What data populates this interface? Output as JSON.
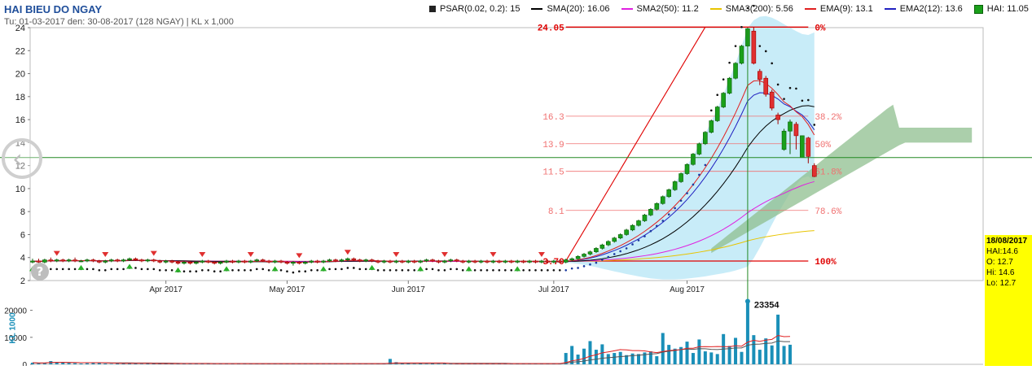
{
  "header": {
    "title": "HAI BIEU DO NGAY",
    "subtitle": "Tu: 01-03-2017 den: 30-08-2017 (128 NGAY) | KL x 1,000"
  },
  "legend": [
    {
      "label": "PSAR(0.02, 0.2): 15",
      "color": "#222222",
      "kind": "square"
    },
    {
      "label": "SMA(20): 16.06",
      "color": "#000000",
      "kind": "line"
    },
    {
      "label": "SMA2(50): 11.2",
      "color": "#e020e0",
      "kind": "line"
    },
    {
      "label": "SMA3(200): 5.56",
      "color": "#e8c400",
      "kind": "line"
    },
    {
      "label": "EMA(9): 13.1",
      "color": "#e02020",
      "kind": "line"
    },
    {
      "label": "EMA2(12): 13.6",
      "color": "#2020c0",
      "kind": "line"
    },
    {
      "label": "HAI: 11.05",
      "color": "#1aa01a",
      "kind": "green"
    }
  ],
  "info_box": {
    "date": "18/08/2017",
    "hai": "HAI:14.6",
    "open": "O: 12.7",
    "high": "Hi: 14.6",
    "low": "Lo: 12.7"
  },
  "colors": {
    "up": "#1aa01a",
    "down": "#e03030",
    "band": "#c8ecf8",
    "cloud": "#8fbf8f",
    "fib": "#f07070",
    "volume": "#1a8fb8",
    "crosshair": "#228822"
  },
  "chart_data": {
    "type": "candlestick",
    "price_axis": {
      "ylim": [
        2,
        24
      ],
      "ticks": [
        2,
        4,
        6,
        8,
        10,
        12,
        14,
        16,
        18,
        20,
        22,
        24
      ]
    },
    "x_ticks": [
      "Apr 2017",
      "May 2017",
      "Jun 2017",
      "Jul 2017",
      "Aug 2017"
    ],
    "x_tick_index": [
      22,
      42,
      62,
      86,
      108
    ],
    "n_days": 128,
    "crosshair": {
      "index": 118,
      "price": 12.7
    },
    "fibonacci": {
      "levels": [
        {
          "value": "24.05",
          "percent": "0%",
          "price": 24.05
        },
        {
          "value": "16.3",
          "percent": "38.2%",
          "price": 16.3
        },
        {
          "value": "13.9",
          "percent": "50%",
          "price": 13.9
        },
        {
          "value": "11.5",
          "percent": "61.8%",
          "price": 11.5
        },
        {
          "value": "8.1",
          "percent": "78.6%",
          "price": 8.1
        },
        {
          "value": "3.70",
          "percent": "100%",
          "price": 3.7
        }
      ],
      "from_index": 88,
      "to_index": 128,
      "trend_from": {
        "index": 88,
        "price": 3.7
      },
      "trend_to": {
        "index": 111,
        "price": 24.05
      }
    },
    "candles": [
      {
        "open": 3.6,
        "close": 3.7,
        "high": 3.9,
        "low": 3.5
      },
      {
        "open": 3.7,
        "close": 3.6,
        "high": 3.9,
        "low": 3.5
      },
      {
        "open": 3.6,
        "close": 3.8,
        "high": 3.9,
        "low": 3.5
      },
      {
        "open": 3.8,
        "close": 3.7,
        "high": 4.0,
        "low": 3.6
      },
      {
        "open": 3.7,
        "close": 3.8,
        "high": 3.9,
        "low": 3.6
      },
      {
        "open": 3.8,
        "close": 3.7,
        "high": 3.9,
        "low": 3.6
      },
      {
        "open": 3.7,
        "close": 3.8,
        "high": 3.9,
        "low": 3.6
      },
      {
        "open": 3.8,
        "close": 3.7,
        "high": 4.0,
        "low": 3.6
      },
      {
        "open": 3.7,
        "close": 3.7,
        "high": 3.8,
        "low": 3.6
      },
      {
        "open": 3.7,
        "close": 3.8,
        "high": 3.9,
        "low": 3.6
      },
      {
        "open": 3.8,
        "close": 3.7,
        "high": 3.9,
        "low": 3.6
      },
      {
        "open": 3.7,
        "close": 3.6,
        "high": 3.8,
        "low": 3.5
      },
      {
        "open": 3.6,
        "close": 3.7,
        "high": 3.8,
        "low": 3.5
      },
      {
        "open": 3.7,
        "close": 3.8,
        "high": 3.9,
        "low": 3.6
      },
      {
        "open": 3.8,
        "close": 3.7,
        "high": 3.9,
        "low": 3.6
      },
      {
        "open": 3.7,
        "close": 3.8,
        "high": 3.9,
        "low": 3.6
      },
      {
        "open": 3.8,
        "close": 3.9,
        "high": 4.0,
        "low": 3.7
      },
      {
        "open": 3.9,
        "close": 3.8,
        "high": 4.0,
        "low": 3.7
      },
      {
        "open": 3.8,
        "close": 3.7,
        "high": 3.9,
        "low": 3.6
      },
      {
        "open": 3.7,
        "close": 3.8,
        "high": 3.9,
        "low": 3.6
      },
      {
        "open": 3.8,
        "close": 3.7,
        "high": 3.9,
        "low": 3.6
      },
      {
        "open": 3.7,
        "close": 3.6,
        "high": 3.8,
        "low": 3.5
      },
      {
        "open": 3.6,
        "close": 3.7,
        "high": 3.8,
        "low": 3.5
      },
      {
        "open": 3.7,
        "close": 3.6,
        "high": 3.8,
        "low": 3.5
      },
      {
        "open": 3.6,
        "close": 3.5,
        "high": 3.7,
        "low": 3.4
      },
      {
        "open": 3.5,
        "close": 3.6,
        "high": 3.7,
        "low": 3.4
      },
      {
        "open": 3.6,
        "close": 3.5,
        "high": 3.7,
        "low": 3.4
      },
      {
        "open": 3.5,
        "close": 3.6,
        "high": 3.7,
        "low": 3.4
      },
      {
        "open": 3.6,
        "close": 3.7,
        "high": 3.8,
        "low": 3.5
      },
      {
        "open": 3.7,
        "close": 3.6,
        "high": 3.8,
        "low": 3.5
      },
      {
        "open": 3.6,
        "close": 3.5,
        "high": 3.7,
        "low": 3.4
      },
      {
        "open": 3.5,
        "close": 3.6,
        "high": 3.7,
        "low": 3.4
      },
      {
        "open": 3.6,
        "close": 3.7,
        "high": 3.8,
        "low": 3.5
      },
      {
        "open": 3.7,
        "close": 3.6,
        "high": 3.8,
        "low": 3.5
      },
      {
        "open": 3.6,
        "close": 3.7,
        "high": 3.8,
        "low": 3.5
      },
      {
        "open": 3.7,
        "close": 3.6,
        "high": 3.8,
        "low": 3.5
      },
      {
        "open": 3.6,
        "close": 3.7,
        "high": 3.8,
        "low": 3.5
      },
      {
        "open": 3.7,
        "close": 3.8,
        "high": 3.9,
        "low": 3.6
      },
      {
        "open": 3.8,
        "close": 3.7,
        "high": 3.9,
        "low": 3.6
      },
      {
        "open": 3.7,
        "close": 3.6,
        "high": 3.8,
        "low": 3.5
      },
      {
        "open": 3.6,
        "close": 3.7,
        "high": 3.8,
        "low": 3.5
      },
      {
        "open": 3.7,
        "close": 3.6,
        "high": 3.8,
        "low": 3.5
      },
      {
        "open": 3.6,
        "close": 3.5,
        "high": 3.7,
        "low": 3.4
      },
      {
        "open": 3.5,
        "close": 3.6,
        "high": 3.7,
        "low": 3.3
      },
      {
        "open": 3.6,
        "close": 3.5,
        "high": 3.7,
        "low": 3.4
      },
      {
        "open": 3.5,
        "close": 3.6,
        "high": 3.7,
        "low": 3.4
      },
      {
        "open": 3.6,
        "close": 3.7,
        "high": 3.8,
        "low": 3.5
      },
      {
        "open": 3.7,
        "close": 3.6,
        "high": 3.8,
        "low": 3.5
      },
      {
        "open": 3.6,
        "close": 3.7,
        "high": 3.8,
        "low": 3.5
      },
      {
        "open": 3.7,
        "close": 3.8,
        "high": 3.9,
        "low": 3.6
      },
      {
        "open": 3.8,
        "close": 3.7,
        "high": 3.9,
        "low": 3.6
      },
      {
        "open": 3.7,
        "close": 3.8,
        "high": 3.9,
        "low": 3.6
      },
      {
        "open": 3.8,
        "close": 3.9,
        "high": 4.0,
        "low": 3.7
      },
      {
        "open": 3.9,
        "close": 3.8,
        "high": 4.0,
        "low": 3.7
      },
      {
        "open": 3.8,
        "close": 3.7,
        "high": 3.9,
        "low": 3.6
      },
      {
        "open": 3.7,
        "close": 3.8,
        "high": 3.9,
        "low": 3.6
      },
      {
        "open": 3.8,
        "close": 3.7,
        "high": 3.9,
        "low": 3.6
      },
      {
        "open": 3.7,
        "close": 3.6,
        "high": 3.8,
        "low": 3.5
      },
      {
        "open": 3.6,
        "close": 3.7,
        "high": 3.8,
        "low": 3.5
      },
      {
        "open": 3.7,
        "close": 3.6,
        "high": 3.8,
        "low": 3.5
      },
      {
        "open": 3.6,
        "close": 3.7,
        "high": 3.8,
        "low": 3.5
      },
      {
        "open": 3.7,
        "close": 3.6,
        "high": 3.8,
        "low": 3.5
      },
      {
        "open": 3.6,
        "close": 3.7,
        "high": 3.8,
        "low": 3.5
      },
      {
        "open": 3.7,
        "close": 3.6,
        "high": 3.8,
        "low": 3.5
      },
      {
        "open": 3.6,
        "close": 3.7,
        "high": 3.8,
        "low": 3.5
      },
      {
        "open": 3.7,
        "close": 3.8,
        "high": 3.9,
        "low": 3.6
      },
      {
        "open": 3.8,
        "close": 3.7,
        "high": 3.9,
        "low": 3.6
      },
      {
        "open": 3.7,
        "close": 3.6,
        "high": 3.8,
        "low": 3.5
      },
      {
        "open": 3.6,
        "close": 3.7,
        "high": 3.8,
        "low": 3.5
      },
      {
        "open": 3.7,
        "close": 3.8,
        "high": 3.9,
        "low": 3.6
      },
      {
        "open": 3.8,
        "close": 3.7,
        "high": 3.9,
        "low": 3.6
      },
      {
        "open": 3.7,
        "close": 3.6,
        "high": 3.8,
        "low": 3.5
      },
      {
        "open": 3.6,
        "close": 3.7,
        "high": 3.8,
        "low": 3.5
      },
      {
        "open": 3.7,
        "close": 3.6,
        "high": 3.8,
        "low": 3.5
      },
      {
        "open": 3.6,
        "close": 3.7,
        "high": 3.8,
        "low": 3.5
      },
      {
        "open": 3.7,
        "close": 3.6,
        "high": 3.8,
        "low": 3.5
      },
      {
        "open": 3.6,
        "close": 3.7,
        "high": 3.8,
        "low": 3.5
      },
      {
        "open": 3.7,
        "close": 3.6,
        "high": 3.8,
        "low": 3.5
      },
      {
        "open": 3.6,
        "close": 3.7,
        "high": 3.8,
        "low": 3.5
      },
      {
        "open": 3.7,
        "close": 3.6,
        "high": 3.8,
        "low": 3.5
      },
      {
        "open": 3.6,
        "close": 3.7,
        "high": 3.8,
        "low": 3.5
      },
      {
        "open": 3.7,
        "close": 3.6,
        "high": 3.8,
        "low": 3.5
      },
      {
        "open": 3.6,
        "close": 3.7,
        "high": 3.8,
        "low": 3.5
      },
      {
        "open": 3.7,
        "close": 3.6,
        "high": 3.8,
        "low": 3.5
      },
      {
        "open": 3.6,
        "close": 3.7,
        "high": 3.8,
        "low": 3.5
      },
      {
        "open": 3.7,
        "close": 3.6,
        "high": 3.8,
        "low": 3.5
      },
      {
        "open": 3.6,
        "close": 3.7,
        "high": 3.8,
        "low": 3.5
      },
      {
        "open": 3.7,
        "close": 3.6,
        "high": 3.8,
        "low": 3.5
      },
      {
        "open": 3.6,
        "close": 3.8,
        "high": 3.9,
        "low": 3.5
      },
      {
        "open": 3.8,
        "close": 3.9,
        "high": 4.0,
        "low": 3.7
      },
      {
        "open": 3.9,
        "close": 4.1,
        "high": 4.2,
        "low": 3.8
      },
      {
        "open": 4.1,
        "close": 4.3,
        "high": 4.4,
        "low": 4.0
      },
      {
        "open": 4.3,
        "close": 4.5,
        "high": 4.6,
        "low": 4.2
      },
      {
        "open": 4.5,
        "close": 4.8,
        "high": 4.9,
        "low": 4.4
      },
      {
        "open": 4.8,
        "close": 5.1,
        "high": 5.2,
        "low": 4.7
      },
      {
        "open": 5.1,
        "close": 5.4,
        "high": 5.5,
        "low": 5.0
      },
      {
        "open": 5.4,
        "close": 5.7,
        "high": 5.8,
        "low": 5.3
      },
      {
        "open": 5.7,
        "close": 6.0,
        "high": 6.1,
        "low": 5.6
      },
      {
        "open": 6.0,
        "close": 6.4,
        "high": 6.5,
        "low": 5.9
      },
      {
        "open": 6.4,
        "close": 6.8,
        "high": 6.9,
        "low": 6.3
      },
      {
        "open": 6.8,
        "close": 7.2,
        "high": 7.3,
        "low": 6.7
      },
      {
        "open": 7.2,
        "close": 7.7,
        "high": 7.8,
        "low": 7.1
      },
      {
        "open": 7.7,
        "close": 8.2,
        "high": 8.3,
        "low": 7.6
      },
      {
        "open": 8.2,
        "close": 8.7,
        "high": 8.8,
        "low": 8.1
      },
      {
        "open": 8.7,
        "close": 9.3,
        "high": 9.4,
        "low": 8.6
      },
      {
        "open": 9.3,
        "close": 9.9,
        "high": 10.0,
        "low": 9.2
      },
      {
        "open": 9.9,
        "close": 10.6,
        "high": 10.7,
        "low": 9.8
      },
      {
        "open": 10.6,
        "close": 11.3,
        "high": 11.4,
        "low": 10.5
      },
      {
        "open": 11.3,
        "close": 12.1,
        "high": 12.2,
        "low": 11.2
      },
      {
        "open": 12.1,
        "close": 13.0,
        "high": 13.1,
        "low": 12.0
      },
      {
        "open": 13.0,
        "close": 13.9,
        "high": 14.0,
        "low": 12.9
      },
      {
        "open": 13.9,
        "close": 14.9,
        "high": 15.0,
        "low": 13.8
      },
      {
        "open": 14.9,
        "close": 15.9,
        "high": 16.0,
        "low": 14.8
      },
      {
        "open": 15.9,
        "close": 17.1,
        "high": 17.2,
        "low": 15.8
      },
      {
        "open": 17.1,
        "close": 18.3,
        "high": 18.4,
        "low": 17.0
      },
      {
        "open": 18.3,
        "close": 19.6,
        "high": 19.7,
        "low": 18.2
      },
      {
        "open": 19.6,
        "close": 20.9,
        "high": 21.0,
        "low": 19.5
      },
      {
        "open": 20.9,
        "close": 22.4,
        "high": 22.5,
        "low": 20.8
      },
      {
        "open": 22.4,
        "close": 23.9,
        "high": 24.0,
        "low": 22.3
      },
      {
        "open": 23.7,
        "close": 20.9,
        "high": 24.05,
        "low": 20.8
      },
      {
        "open": 20.2,
        "close": 19.5,
        "high": 20.4,
        "low": 19.0
      },
      {
        "open": 19.6,
        "close": 18.2,
        "high": 19.8,
        "low": 18.0
      },
      {
        "open": 18.4,
        "close": 17.0,
        "high": 18.6,
        "low": 16.8
      },
      {
        "open": 16.4,
        "close": 16.0,
        "high": 16.6,
        "low": 15.6
      },
      {
        "open": 13.4,
        "close": 15.0,
        "high": 15.2,
        "low": 13.3
      },
      {
        "open": 15.0,
        "close": 15.8,
        "high": 16.0,
        "low": 13.0
      },
      {
        "open": 15.6,
        "close": 14.6,
        "high": 15.8,
        "low": 13.4
      },
      {
        "open": 12.7,
        "close": 14.6,
        "high": 14.6,
        "low": 12.7
      },
      {
        "open": 14.4,
        "close": 12.8,
        "high": 14.5,
        "low": 12.2
      },
      {
        "open": 12.0,
        "close": 11.05,
        "high": 12.2,
        "low": 11.0
      }
    ],
    "volume_axis": {
      "ylim": [
        0,
        25000
      ],
      "ticks": [
        0,
        10000,
        20000
      ],
      "label": "KL 1000"
    },
    "volume": [
      600,
      400,
      500,
      1200,
      900,
      700,
      500,
      400,
      300,
      400,
      600,
      500,
      300,
      200,
      300,
      400,
      500,
      300,
      200,
      300,
      300,
      400,
      200,
      300,
      200,
      300,
      400,
      300,
      200,
      300,
      200,
      300,
      200,
      300,
      200,
      400,
      300,
      200,
      300,
      200,
      300,
      200,
      300,
      200,
      300,
      200,
      300,
      200,
      300,
      400,
      300,
      200,
      300,
      200,
      300,
      200,
      300,
      200,
      300,
      2000,
      800,
      400,
      300,
      200,
      300,
      200,
      300,
      200,
      300,
      200,
      300,
      200,
      300,
      200,
      300,
      200,
      300,
      200,
      300,
      200,
      300,
      200,
      300,
      200,
      300,
      200,
      300,
      200,
      4200,
      6800,
      3600,
      5800,
      8600,
      5400,
      7400,
      3800,
      4200,
      4600,
      3400,
      4000,
      3800,
      4400,
      4800,
      3000,
      11600,
      7200,
      5800,
      6400,
      8400,
      4200,
      9200,
      4800,
      4400,
      3800,
      11200,
      6800,
      9800,
      4600,
      23354,
      10800,
      5400,
      9600,
      7000,
      18400,
      6800,
      7250
    ],
    "volume_max_label": "23354",
    "volume_last_label": "7250"
  }
}
